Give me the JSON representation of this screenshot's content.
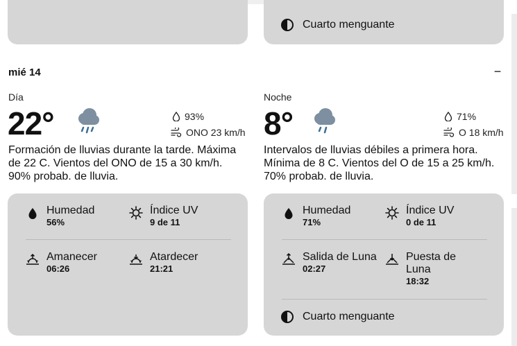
{
  "previous": {
    "moon_phase": "Cuarto menguante"
  },
  "day": {
    "title": "mié 14",
    "collapse": "−",
    "day_part": {
      "label": "Día",
      "temp": "22°",
      "humidity": "93%",
      "wind": "ONO 23 km/h",
      "description": "Formación de lluvias durante la tarde. Máxima de 22 C. Vientos del ONO de 15 a 30 km/h. 90% probab. de lluvia.",
      "details": {
        "humidity_label": "Humedad",
        "humidity_value": "56%",
        "uv_label": "Índice UV",
        "uv_value": "9 de 11",
        "sunrise_label": "Amanecer",
        "sunrise_value": "06:26",
        "sunset_label": "Atardecer",
        "sunset_value": "21:21"
      }
    },
    "night_part": {
      "label": "Noche",
      "temp": "8°",
      "humidity": "71%",
      "wind": "O 18 km/h",
      "description": "Intervalos de lluvias débiles a primera hora. Mínima de 8 C. Vientos del O de 15 a 25 km/h. 70% probab. de lluvia.",
      "details": {
        "humidity_label": "Humedad",
        "humidity_value": "71%",
        "uv_label": "Índice UV",
        "uv_value": "0 de 11",
        "moonrise_label": "Salida de Luna",
        "moonrise_value": "02:27",
        "moonset_label": "Puesta de Luna",
        "moonset_value": "18:32",
        "moon_phase": "Cuarto menguante"
      }
    }
  },
  "colors": {
    "card": "#d6d6d6",
    "cloud": "#7d8fa0",
    "rain": "#3c6f95"
  }
}
